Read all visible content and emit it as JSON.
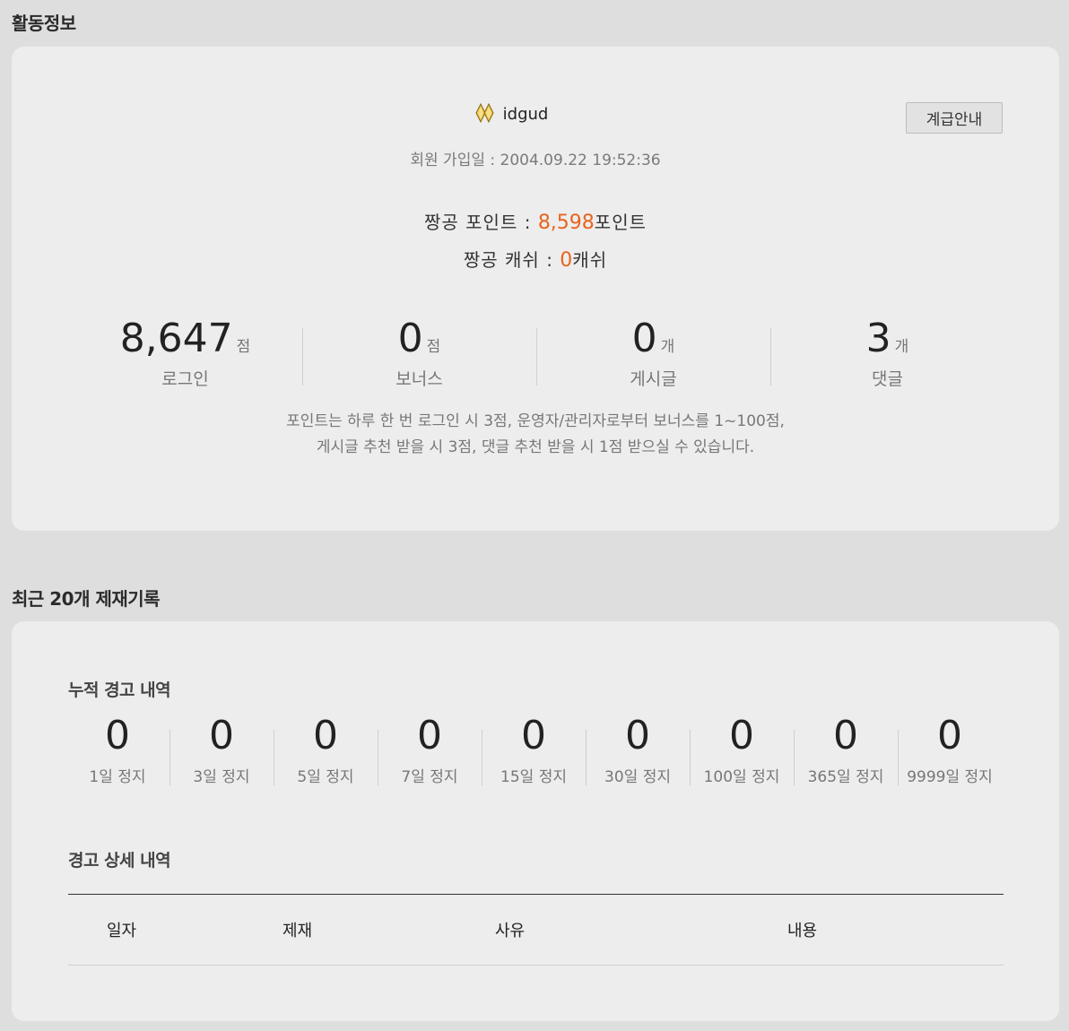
{
  "activity": {
    "section_title": "활동정보",
    "username": "idgud",
    "grade_button_label": "계급안내",
    "join_label": "회원 가입일 : ",
    "join_date": "2004.09.22 19:52:36",
    "points": {
      "label": "짱공 포인트 : ",
      "value": "8,598",
      "unit": "포인트"
    },
    "cash": {
      "label": "짱공 캐쉬 : ",
      "value": "0",
      "unit": "캐쉬"
    },
    "stats": [
      {
        "value": "8,647",
        "unit": "점",
        "label": "로그인"
      },
      {
        "value": "0",
        "unit": "점",
        "label": "보너스"
      },
      {
        "value": "0",
        "unit": "개",
        "label": "게시글"
      },
      {
        "value": "3",
        "unit": "개",
        "label": "댓글"
      }
    ],
    "note_line1": "포인트는 하루 한 번  로그인 시 3점, 운영자/관리자로부터  보너스를 1~100점,",
    "note_line2": "게시글 추천 받을 시 3점, 댓글 추천 받을 시 1점 받으실 수 있습니다.",
    "accent_color": "#e8641e"
  },
  "sanctions": {
    "section_title": "최근 20개 제재기록",
    "cumulative_title": "누적 경고 내역",
    "counts": [
      {
        "value": "0",
        "label": "1일 정지"
      },
      {
        "value": "0",
        "label": "3일 정지"
      },
      {
        "value": "0",
        "label": "5일 정지"
      },
      {
        "value": "0",
        "label": "7일 정지"
      },
      {
        "value": "0",
        "label": "15일 정지"
      },
      {
        "value": "0",
        "label": "30일 정지"
      },
      {
        "value": "0",
        "label": "100일 정지"
      },
      {
        "value": "0",
        "label": "365일 정지"
      },
      {
        "value": "0",
        "label": "9999일 정지"
      }
    ],
    "detail_title": "경고 상세 내역",
    "table_headers": {
      "date": "일자",
      "sanction": "제재",
      "reason": "사유",
      "content": "내용"
    },
    "table_rows": []
  }
}
